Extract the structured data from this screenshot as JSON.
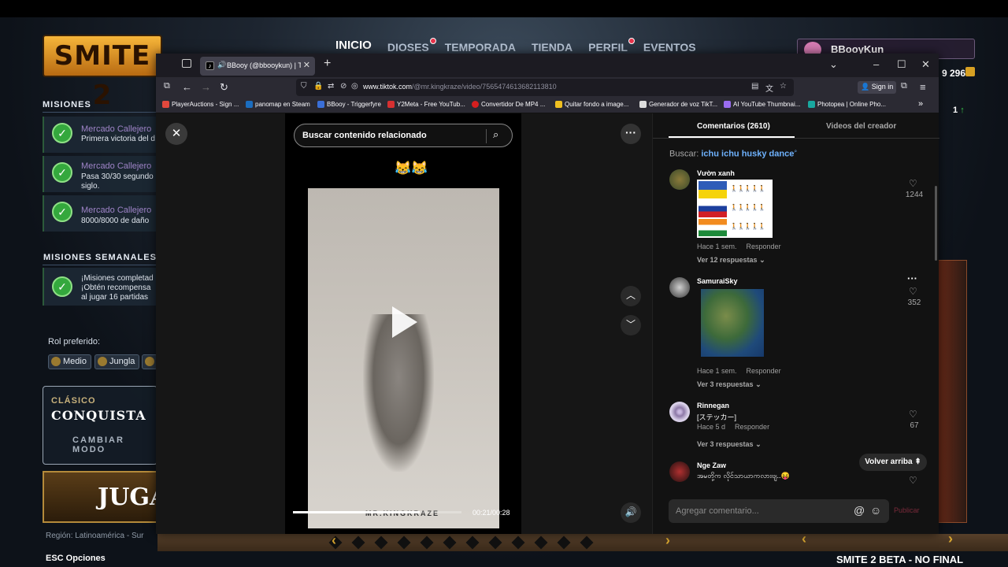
{
  "game": {
    "logo": "SMITE 2",
    "nav": [
      {
        "label": "INICIO",
        "dot": false
      },
      {
        "label": "DIOSES",
        "dot": true
      },
      {
        "label": "TEMPORADA",
        "dot": false
      },
      {
        "label": "TIENDA",
        "dot": false
      },
      {
        "label": "PERFIL",
        "dot": true
      },
      {
        "label": "EVENTOS",
        "dot": false
      }
    ],
    "username": "BBooyKun",
    "gold": "9 296",
    "rank": "1",
    "missions_title": "MISIONES",
    "missions": [
      {
        "title": "Mercado Callejero",
        "desc1": "Primera victoria del d",
        "desc2": ""
      },
      {
        "title": "Mercado Callejero",
        "desc1": "Pasa 30/30 segundo",
        "desc2": "siglo."
      },
      {
        "title": "Mercado Callejero",
        "desc1": "8000/8000 de daño",
        "desc2": ""
      }
    ],
    "weekly_title": "MISIONES SEMANALES",
    "weekly": {
      "line1": "¡Misiones completad",
      "line2": "¡Obtén recompensa",
      "line3": "al jugar 16 partidas"
    },
    "role_label": "Rol preferido:",
    "roles": [
      "Medio",
      "Jungla"
    ],
    "mode_category": "CLÁSICO",
    "mode_name": "CONQUISTA",
    "change_mode": "CAMBIAR MODO",
    "play": "JUGA",
    "region": "Región: Latinoamérica - Sur",
    "esc": "ESC  Opciones",
    "beta": "SMITE 2 BETA - NO FINAL"
  },
  "browser": {
    "tab_title": "BBooy (@bbooykun) | TikTok",
    "url_host": "www.tiktok.com",
    "url_path": "/@mr.kingkraze/video/7565474613682113810",
    "signin": "Sign in",
    "bookmarks": [
      {
        "label": "PlayerAuctions - Sign ...",
        "color": "#e2483d"
      },
      {
        "label": "panomap en Steam",
        "color": "#1b6dbf"
      },
      {
        "label": "BBooy - Triggerfyre",
        "color": "#3a6fd8"
      },
      {
        "label": "Y2Meta - Free YouTub...",
        "color": "#d63031"
      },
      {
        "label": "Convertidor De MP4 ...",
        "color": "#d61f1f"
      },
      {
        "label": "Quitar fondo a image...",
        "color": "#f0c020"
      },
      {
        "label": "Generador de voz TikT...",
        "color": "#dddddd"
      },
      {
        "label": "AI YouTube Thumbnai...",
        "color": "#9a6cf0"
      },
      {
        "label": "Photopea | Online Pho...",
        "color": "#19a8a0"
      }
    ]
  },
  "tiktok": {
    "search_placeholder": "Buscar contenido relacionado",
    "emoji": "😹😹",
    "watermark": "MR.KINGKRAZE",
    "time": "00:21/00:28",
    "progress": 0.75,
    "tab_comments": "Comentarios (2610)",
    "tab_creator": "Videos del creador",
    "buscar_label": "Buscar:",
    "buscar_query": "ichu ichu husky dance",
    "comments": [
      {
        "user": "Vườn xanh",
        "time": "Hace 1 sem.",
        "reply": "Responder",
        "replies": "Ver 12 respuestas",
        "likes": "1244"
      },
      {
        "user": "SamuraiSky",
        "time": "Hace 1 sem.",
        "reply": "Responder",
        "replies": "Ver 3 respuestas",
        "likes": "352"
      },
      {
        "user": "Rinnegan",
        "text": "[ステッカー]",
        "time": "Hace 5 d",
        "reply": "Responder",
        "replies": "Ver 3 respuestas",
        "likes": "67"
      },
      {
        "user": "Nge Zaw",
        "text": "အမတို့က လိုင်သာယာကလားဗျ..😝",
        "likes": ""
      }
    ],
    "back_to_top": "Volver arriba",
    "add_comment": "Agregar comentario...",
    "publish": "Publicar"
  }
}
